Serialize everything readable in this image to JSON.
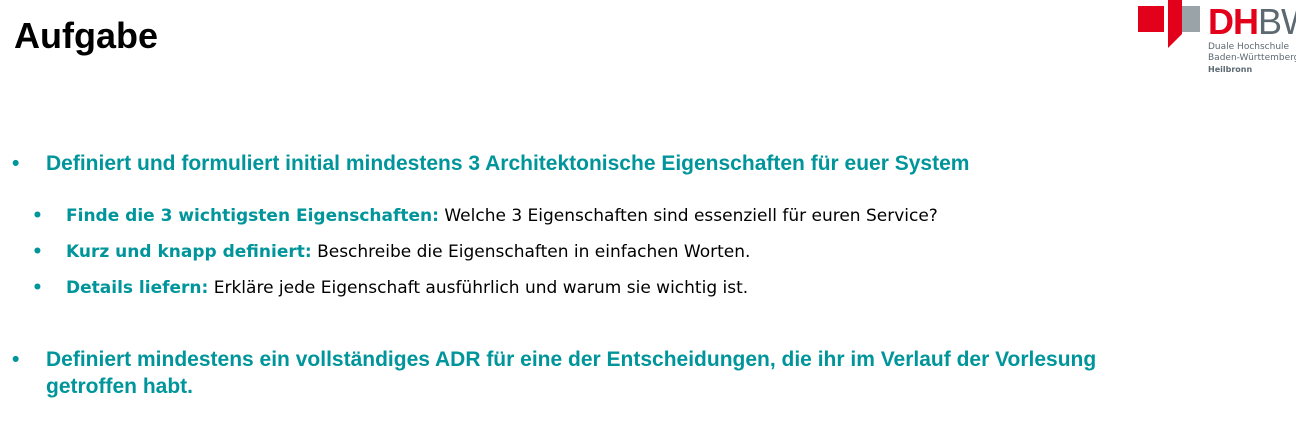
{
  "slide": {
    "title": "Aufgabe"
  },
  "logo": {
    "mark_dh": "DH",
    "mark_bw": "BW",
    "line1": "Duale Hochschule",
    "line2": "Baden-Württemberg",
    "city": "Heilbronn",
    "colors": {
      "red": "#e2001a",
      "gray": "#5c6971"
    }
  },
  "content": {
    "bullet_char": "•",
    "items": [
      {
        "text": "Definiert und formuliert initial mindestens 3 Architektonische Eigenschaften für euer System",
        "sub_items": [
          {
            "lead": "Finde die 3 wichtigsten Eigenschaften:",
            "text": " Welche 3 Eigenschaften sind essenziell für euren Service?"
          },
          {
            "lead": "Kurz und knapp definiert:",
            "text": " Beschreibe die Eigenschaften in einfachen Worten."
          },
          {
            "lead": "Details liefern:",
            "text": " Erkläre jede Eigenschaft ausführlich und warum sie wichtig ist."
          }
        ]
      },
      {
        "text": "Definiert mindestens ein vollständiges ADR für eine der Entscheidungen, die ihr im Verlauf der Vorlesung getroffen habt."
      }
    ]
  },
  "colors": {
    "accent": "#00959a",
    "text": "#000000",
    "background": "#ffffff"
  }
}
